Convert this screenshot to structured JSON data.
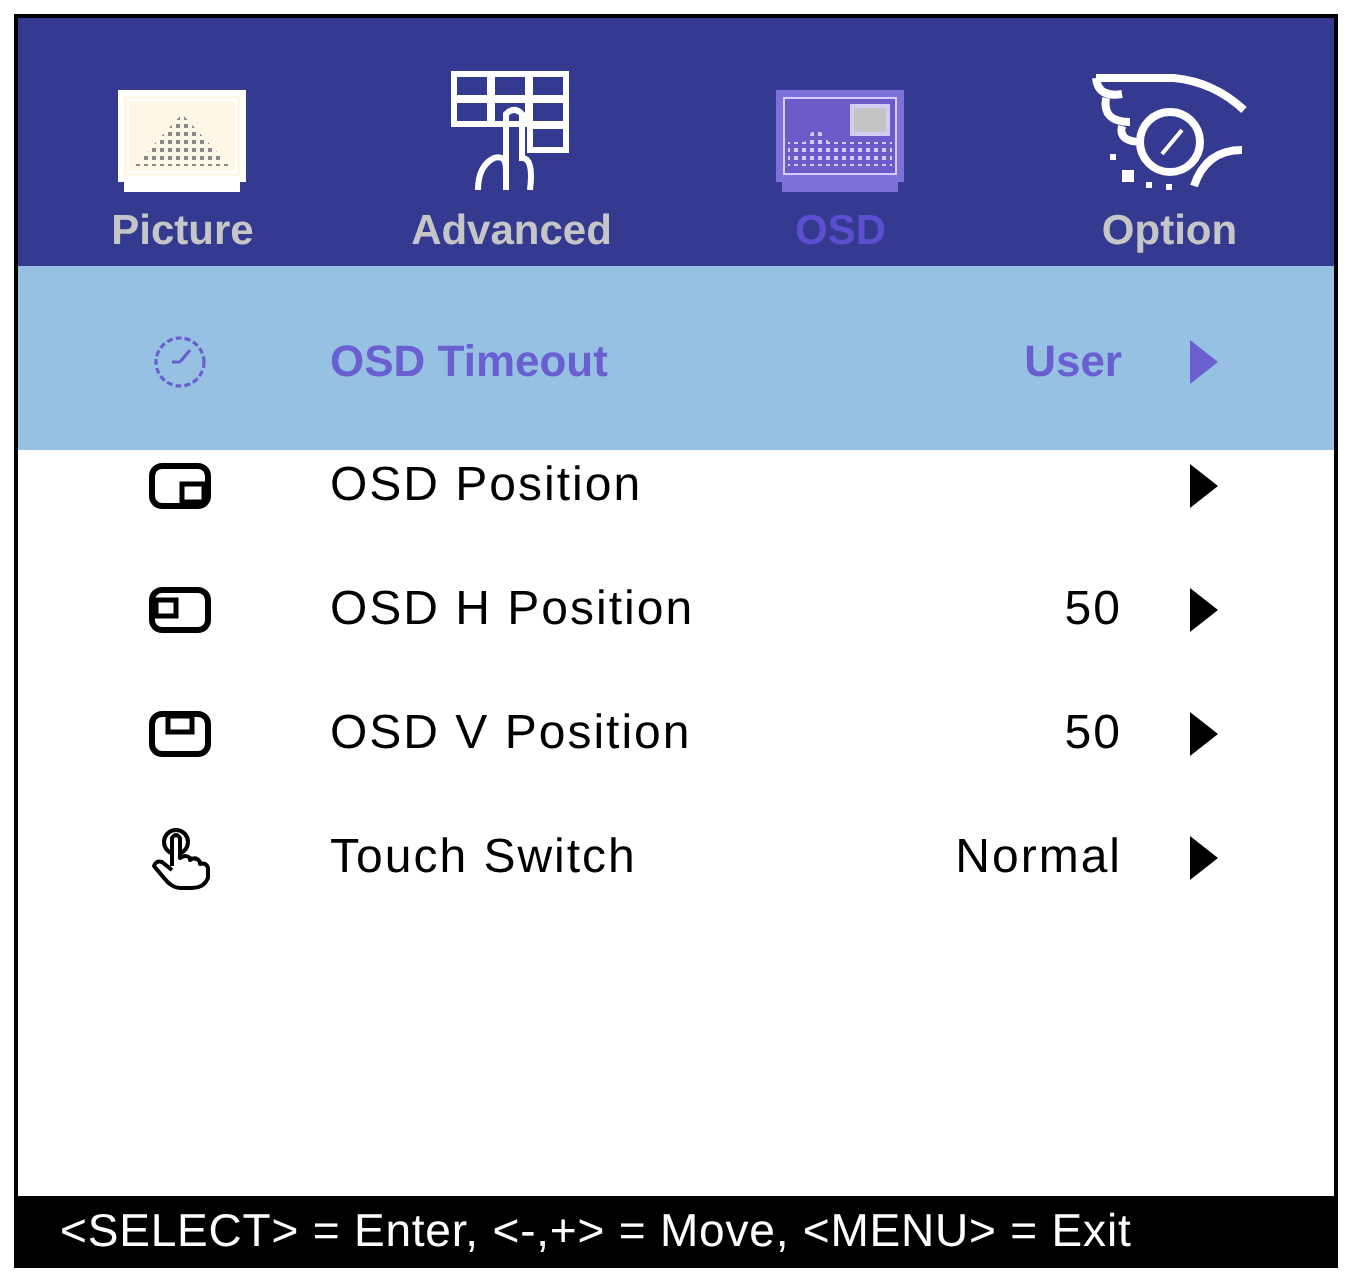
{
  "tabs": [
    {
      "label": "Picture",
      "selected": false
    },
    {
      "label": "Advanced",
      "selected": false
    },
    {
      "label": "OSD",
      "selected": true
    },
    {
      "label": "Option",
      "selected": false
    }
  ],
  "menu_items": [
    {
      "label": "OSD Timeout",
      "value": "User",
      "selected": true
    },
    {
      "label": "OSD Position",
      "selected": false
    },
    {
      "label": "OSD H Position",
      "value": "50",
      "selected": false
    },
    {
      "label": "OSD V Position",
      "value": "50",
      "selected": false
    },
    {
      "label": "Touch Switch",
      "value": "Normal",
      "selected": false
    }
  ],
  "status_bar": {
    "text": "<SELECT> = Enter, <-,+> = Move, <MENU> = Exit"
  }
}
